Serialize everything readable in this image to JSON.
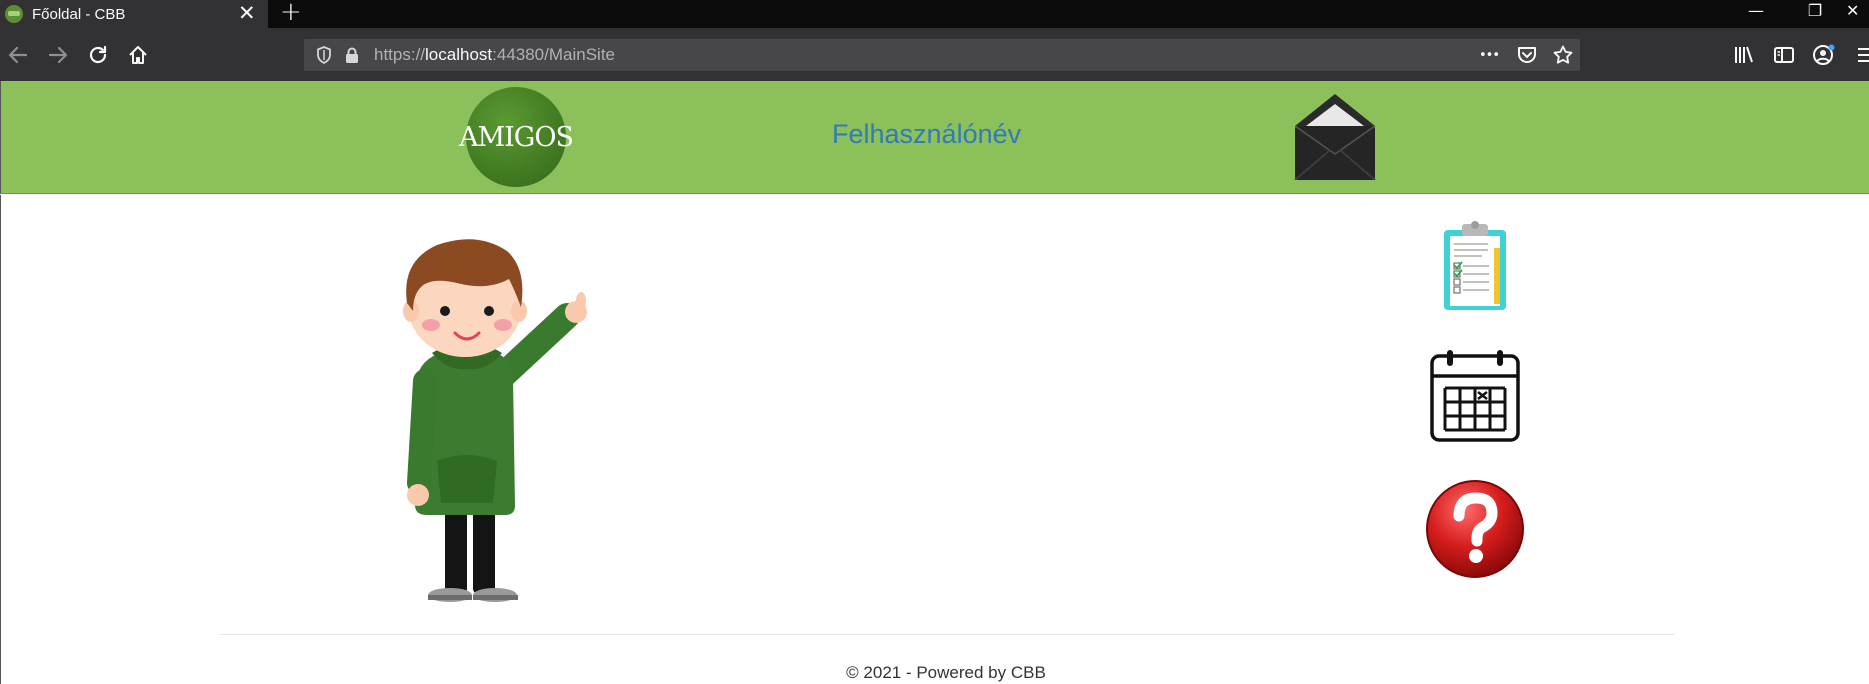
{
  "browser": {
    "tab_title": "Főoldal - CBB",
    "tab_close_glyph": "✕",
    "new_tab_glyph": "+",
    "url_scheme": "https://",
    "url_host": "localhost",
    "url_rest": ":44380/MainSite",
    "page_actions_glyph": "•••",
    "window_controls": {
      "minimize": "—",
      "restore": "❐",
      "close": "✕"
    }
  },
  "header": {
    "logo_text": "AMIGOS",
    "username": "Felhasználónév",
    "background_color": "#8bc05b",
    "username_color": "#337ab7"
  },
  "main": {
    "character_alt": "waving-boy-illustration",
    "side_icons": [
      "clipboard-checklist-icon",
      "calendar-icon",
      "help-question-icon"
    ]
  },
  "footer": {
    "text": "© 2021 - Powered by CBB"
  }
}
